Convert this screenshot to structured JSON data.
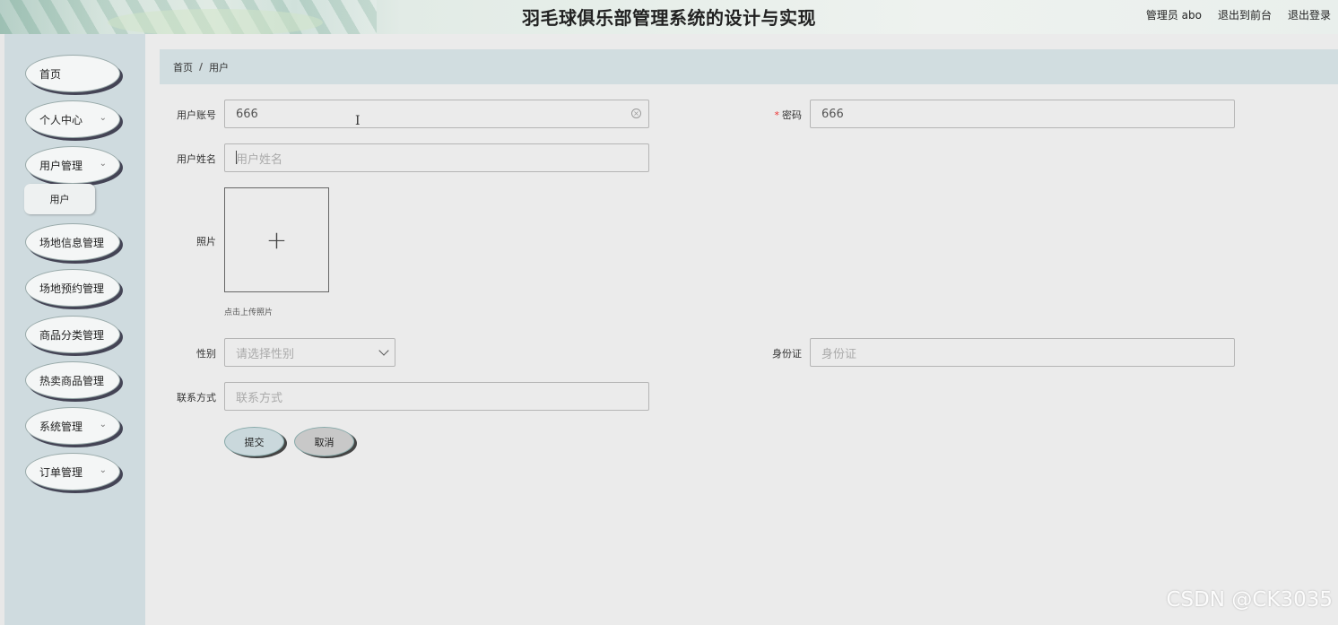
{
  "header": {
    "title": "羽毛球俱乐部管理系统的设计与实现",
    "user_label": "管理员 abo",
    "front_link": "退出到前台",
    "logout_link": "退出登录"
  },
  "sidebar": {
    "items": [
      {
        "label": "首页"
      },
      {
        "label": "个人中心",
        "chevron": "⌄"
      },
      {
        "label": "用户管理",
        "chevron": "⌄"
      },
      {
        "label": "场地信息管理"
      },
      {
        "label": "场地预约管理"
      },
      {
        "label": "商品分类管理"
      },
      {
        "label": "热卖商品管理"
      },
      {
        "label": "系统管理",
        "chevron": "⌄"
      },
      {
        "label": "订单管理",
        "chevron": "⌄"
      }
    ],
    "submenu": {
      "label": "用户"
    }
  },
  "breadcrumb": {
    "home": "首页",
    "separator": "/",
    "current": "用户"
  },
  "form": {
    "account": {
      "label": "用户账号",
      "value": "666"
    },
    "password": {
      "label": "密码",
      "required_mark": "*",
      "value": "666"
    },
    "name": {
      "label": "用户姓名",
      "placeholder": "用户姓名"
    },
    "photo": {
      "label": "照片",
      "tip": "点击上传照片",
      "plus": "+"
    },
    "gender": {
      "label": "性别",
      "placeholder": "请选择性别"
    },
    "idcard": {
      "label": "身份证",
      "placeholder": "身份证"
    },
    "contact": {
      "label": "联系方式",
      "placeholder": "联系方式"
    }
  },
  "buttons": {
    "submit": "提交",
    "cancel": "取消"
  },
  "watermark": "CSDN @CK3035"
}
